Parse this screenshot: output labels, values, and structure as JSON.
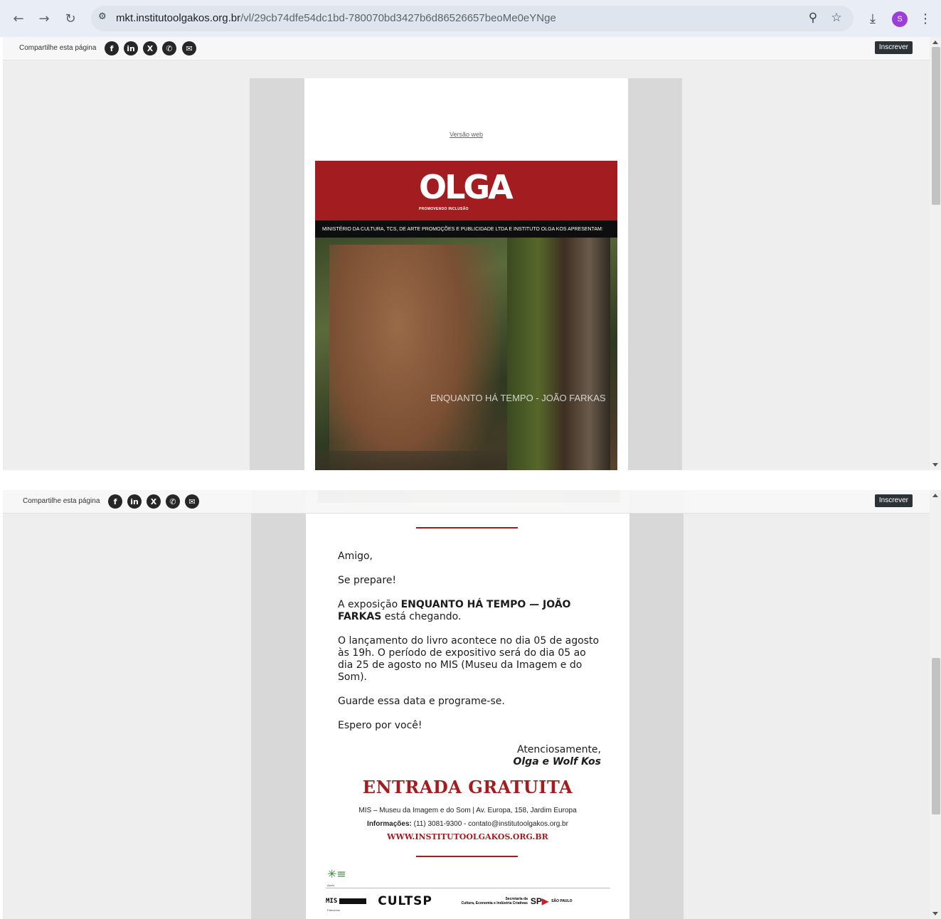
{
  "browser": {
    "url_host": "mkt.institutoolgakos.org.br",
    "url_path": "/vl/29cb74dfe54dc1bd-780070bd3427b6d86526657beoMe0eYNge",
    "profile_initial": "S",
    "icons": {
      "back": "arrow-left-icon",
      "forward": "arrow-right-icon",
      "reload": "reload-icon",
      "site_info": "tune-icon",
      "zoom": "zoom-icon",
      "bookmark": "star-icon",
      "download": "download-icon",
      "menu": "kebab-icon"
    }
  },
  "share_bar": {
    "label": "Compartilhe esta página",
    "subscribe_label": "Inscrever",
    "socials": [
      {
        "name": "facebook-icon",
        "glyph": "f"
      },
      {
        "name": "linkedin-icon",
        "glyph": "in"
      },
      {
        "name": "x-icon",
        "glyph": "𝕏"
      },
      {
        "name": "whatsapp-icon",
        "glyph": "✆"
      },
      {
        "name": "email-icon",
        "glyph": "✉"
      }
    ]
  },
  "email": {
    "web_version_link": "Versão web",
    "logo_text": "OLGA",
    "logo_sub": "PROMOVENDO INCLUSÃO",
    "presenters": "MINISTÉRIO DA CULTURA, TCS, DE ARTE PROMOÇÕES E PUBLICIDADE LTDA E INSTITUTO OLGA KOS APRESENTAM:",
    "photo_caption": "ENQUANTO HÁ TEMPO - JOÃO FARKAS",
    "letter": {
      "greeting": "Amigo,",
      "line1": "Se prepare!",
      "line2_prefix": "A exposição ",
      "line2_bold": "ENQUANTO HÁ TEMPO  — JOÃO FARKAS",
      "line2_suffix": " está chegando.",
      "line3": "O lançamento do livro acontece no dia 05 de agosto às 19h. O período de expositivo será do dia 05 ao dia 25 de agosto no MIS (Museu da Imagem e do Som).",
      "line4": "Guarde essa data e programe-se.",
      "line5": "Espero por você!",
      "closing": "Atenciosamente,",
      "signature": "Olga e Wolf Kos"
    },
    "entrada": "ENTRADA GRATUITA",
    "venue": "MIS – Museu da Imagem e do Som  | Av. Europa, 158, Jardim Europa",
    "contact_label": "Informações:",
    "contact": " (11) 3081-9300 - contato@institutoolgakos.org.br",
    "website": "WWW.INSTITUTOOLGAKOS.ORG.BR",
    "sponsors": {
      "apoio": "Apoio",
      "patrocinio": "Patrocínio",
      "mis": "MIS",
      "cultsp": "CULTSP",
      "secretaria": "Secretaria da",
      "secretaria2": "Cultura, Economia e Indústria Criativas",
      "sp": "SP",
      "sao_paulo": "SÃO PAULO"
    }
  },
  "colors": {
    "brand_red": "#a31d20",
    "subscribe_bg": "#2c3338"
  }
}
